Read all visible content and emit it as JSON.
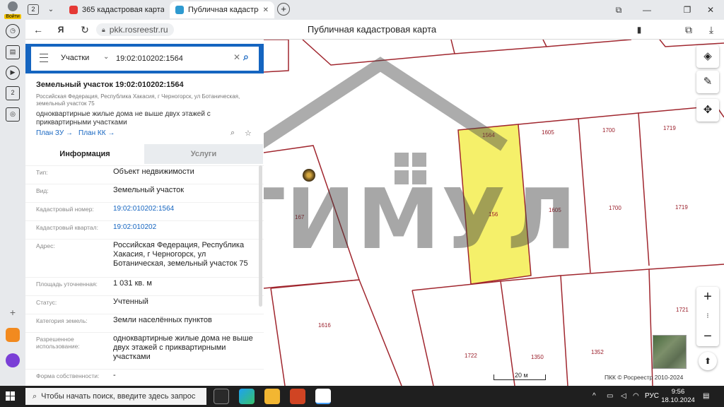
{
  "browser": {
    "profile_label": "Войти",
    "tab_count": "2",
    "tabs": [
      {
        "label": "365 кадастровая карта п",
        "favicon_color": "#e53935"
      },
      {
        "label": "Публичная кадастрова",
        "favicon_color": "#2e9ad0"
      }
    ],
    "new_tab": "+",
    "url": "pkk.rosreestr.ru",
    "page_title": "Публичная кадастровая карта",
    "rail_counter": "2"
  },
  "panel": {
    "search": {
      "category": "Участки",
      "query": "19:02:010202:1564"
    },
    "object_title": "Земельный участок 19:02:010202:1564",
    "address_short": "Российская Федерация, Республика Хакасия, г Черногорск, ул Ботаническая, земельный участок 75",
    "usage_short": "одноквартирные жилые дома не выше двух этажей с приквартирными участками",
    "links": {
      "plan_zu": "План ЗУ →",
      "plan_kk": "План КК →"
    },
    "tabs": {
      "info": "Информация",
      "services": "Услуги"
    },
    "rows": [
      {
        "label": "Тип:",
        "value": "Объект недвижимости"
      },
      {
        "label": "Вид:",
        "value": "Земельный участок"
      },
      {
        "label": "Кадастровый номер:",
        "value": "19:02:010202:1564"
      },
      {
        "label": "Кадастровый квартал:",
        "value": "19:02:010202"
      },
      {
        "label": "Адрес:",
        "value": "Российская Федерация, Республика Хакасия, г Черногорск, ул Ботаническая, земельный участок 75"
      },
      {
        "label": "Площадь уточненная:",
        "value": "1 031 кв. м"
      },
      {
        "label": "Статус:",
        "value": "Учтенный"
      },
      {
        "label": "Категория земель:",
        "value": "Земли населённых пунктов"
      },
      {
        "label": "Разрешенное использование:",
        "value": "одноквартирные жилые дома не выше двух этажей с приквартирными участками"
      },
      {
        "label": "Форма собственности:",
        "value": "-"
      }
    ]
  },
  "map": {
    "parcel_labels": {
      "p1564_top": "1564",
      "p1564_mid": "156",
      "p1605_top": "1605",
      "p1605_mid": "1605",
      "p1700_top": "1700",
      "p1700_mid": "1700",
      "p1719_top": "1719",
      "p1719_mid": "1719",
      "p167": "167",
      "p1616": "1616",
      "p1721": "1721",
      "p1722": "1722",
      "p1350": "1350",
      "p1352": "1352"
    },
    "watermark": "СТИМУЛ",
    "scale": "20 м",
    "copyright": "ПКК © Росреестр 2010-2024",
    "selected_fill": "#f5f06a",
    "boundary_color": "#a0262e"
  },
  "taskbar": {
    "search_placeholder": "Чтобы начать поиск, введите здесь запрос",
    "lang": "РУС",
    "time": "9:56",
    "date": "18.10.2024"
  }
}
